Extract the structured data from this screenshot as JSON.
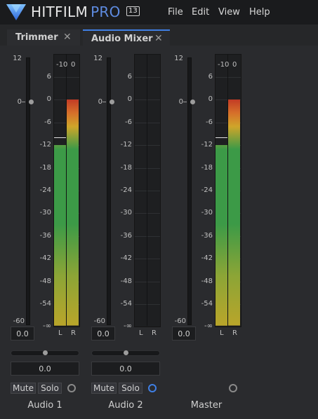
{
  "app": {
    "brand": "HITFILM",
    "edition": "PRO",
    "version": "13"
  },
  "menu": [
    "File",
    "Edit",
    "View",
    "Help"
  ],
  "tabs": [
    {
      "label": "Trimmer",
      "close": "✕",
      "active": false
    },
    {
      "label": "Audio Mixer",
      "close": "✕",
      "active": true
    }
  ],
  "fader_scale": {
    "top": "12",
    "zero": "0",
    "bottom": "-60"
  },
  "meter_scale": [
    "6",
    "0",
    "-6",
    "-12",
    "-18",
    "-24",
    "-30",
    "-36",
    "-42",
    "-48",
    "-54",
    "-∞"
  ],
  "peak_labels": {
    "left": "-10",
    "right": "0"
  },
  "channel_labels": {
    "left": "L",
    "right": "R"
  },
  "strips": [
    {
      "name": "Audio 1",
      "volume": "0.0",
      "pan": "0.0",
      "mute": "Mute",
      "solo": "Solo",
      "active": false,
      "left_level_db": -12,
      "right_level_db": 0,
      "peak_db": -10
    },
    {
      "name": "Audio 2",
      "volume": "0.0",
      "pan": "0.0",
      "mute": "Mute",
      "solo": "Solo",
      "active": true,
      "left_level_db": null,
      "right_level_db": null,
      "peak_db": null
    },
    {
      "name": "Master",
      "volume": "0.0",
      "active": false,
      "left_level_db": -12,
      "right_level_db": 0,
      "peak_db": -10
    }
  ],
  "colors": {
    "accent": "#3f7fe4",
    "meter_green": "#3c9a47",
    "meter_yellow": "#b9a52a",
    "meter_red": "#c23b25"
  }
}
